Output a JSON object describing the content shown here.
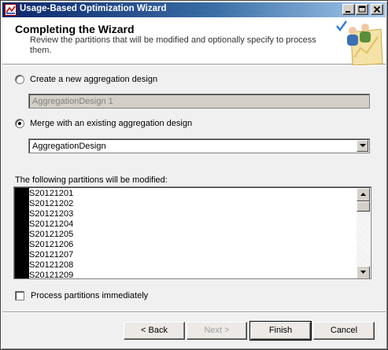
{
  "window": {
    "title": "Usage-Based Optimization Wizard"
  },
  "header": {
    "title": "Completing the Wizard",
    "subtitle": "Review the partitions that will be modified and optionally specify to process them."
  },
  "options": {
    "create_new_label": "Create a new aggregation design",
    "create_new_selected": false,
    "new_design_name": "AggregationDesign 1",
    "merge_label": "Merge with an existing aggregation design",
    "merge_selected": true,
    "existing_design_value": "AggregationDesign"
  },
  "partitions": {
    "label": "The following partitions will be modified:",
    "items": [
      "S20121201",
      "S20121202",
      "S20121203",
      "S20121204",
      "S20121205",
      "S20121206",
      "S20121207",
      "S20121208",
      "S20121209"
    ]
  },
  "process": {
    "label": "Process partitions immediately",
    "checked": false
  },
  "buttons": {
    "back": "< Back",
    "next": "Next >",
    "finish": "Finish",
    "cancel": "Cancel"
  },
  "icons": {
    "app": "wizard-app-icon",
    "header_art": "users-chart-icon",
    "minimize": "minimize-icon",
    "maximize": "maximize-icon",
    "close": "close-icon"
  },
  "colors": {
    "titlebar_start": "#0a246a",
    "titlebar_end": "#a6caf0",
    "window_bg": "#f0f0f0"
  }
}
